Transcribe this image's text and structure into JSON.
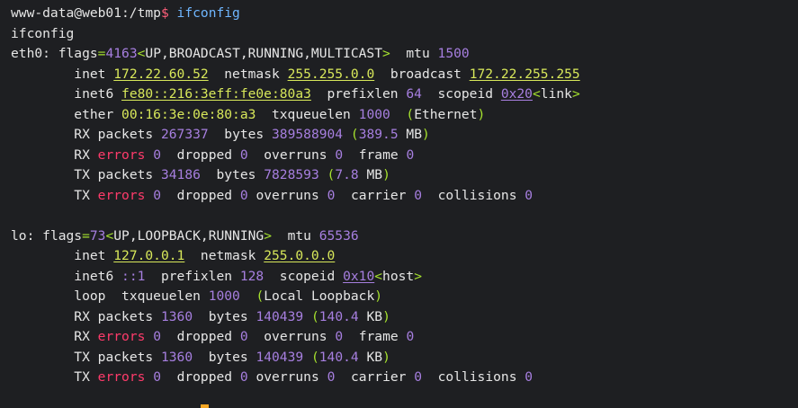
{
  "prompt": {
    "user_host": "www-data@web01",
    "path": ":/tmp",
    "symbol": "$",
    "command": "ifconfig"
  },
  "echo": "ifconfig",
  "eth0": {
    "name": "eth0",
    "flags_label": "flags",
    "flags_value": "4163",
    "flags_list": "UP,BROADCAST,RUNNING,MULTICAST",
    "mtu_label": "mtu",
    "mtu": "1500",
    "inet_label": "inet",
    "inet": "172.22.60.52",
    "netmask_label": "netmask",
    "netmask": "255.255.0.0",
    "broadcast_label": "broadcast",
    "broadcast": "172.22.255.255",
    "inet6_label": "inet6",
    "inet6": "fe80::216:3eff:fe0e:80a3",
    "prefixlen_label": "prefixlen",
    "prefixlen": "64",
    "scopeid_label": "scopeid",
    "scopeid": "0x20",
    "scope": "link",
    "ether_label": "ether",
    "ether": "00:16:3e:0e:80:a3",
    "txqueuelen_label": "txqueuelen",
    "txqueuelen": "1000",
    "link_type": "Ethernet",
    "rx_packets": "267337",
    "rx_bytes": "389588904",
    "rx_bytes_h": "389.5",
    "rx_unit": "MB",
    "rx_errors": "0",
    "rx_dropped": "0",
    "rx_overruns": "0",
    "rx_frame": "0",
    "tx_packets": "34186",
    "tx_bytes": "7828593",
    "tx_bytes_h": "7.8",
    "tx_unit": "MB",
    "tx_errors": "0",
    "tx_dropped": "0",
    "tx_overruns": "0",
    "tx_carrier": "0",
    "tx_collisions": "0"
  },
  "lo": {
    "name": "lo",
    "flags_value": "73",
    "flags_list": "UP,LOOPBACK,RUNNING",
    "mtu": "65536",
    "inet": "127.0.0.1",
    "netmask": "255.0.0.0",
    "inet6": "::1",
    "prefixlen": "128",
    "scopeid": "0x10",
    "scope": "host",
    "loop_label": "loop",
    "txqueuelen": "1000",
    "link_type": "Local Loopback",
    "rx_packets": "1360",
    "rx_bytes": "140439",
    "rx_bytes_h": "140.4",
    "rx_unit": "KB",
    "rx_errors": "0",
    "rx_dropped": "0",
    "rx_overruns": "0",
    "rx_frame": "0",
    "tx_packets": "1360",
    "tx_bytes": "140439",
    "tx_bytes_h": "140.4",
    "tx_unit": "KB",
    "tx_errors": "0",
    "tx_dropped": "0",
    "tx_overruns": "0",
    "tx_carrier": "0",
    "tx_collisions": "0"
  },
  "labels": {
    "rx": "RX",
    "tx": "TX",
    "packets": "packets",
    "bytes": "bytes",
    "errors": "errors",
    "dropped": "dropped",
    "overruns": "overruns",
    "frame": "frame",
    "carrier": "carrier",
    "collisions": "collisions"
  }
}
